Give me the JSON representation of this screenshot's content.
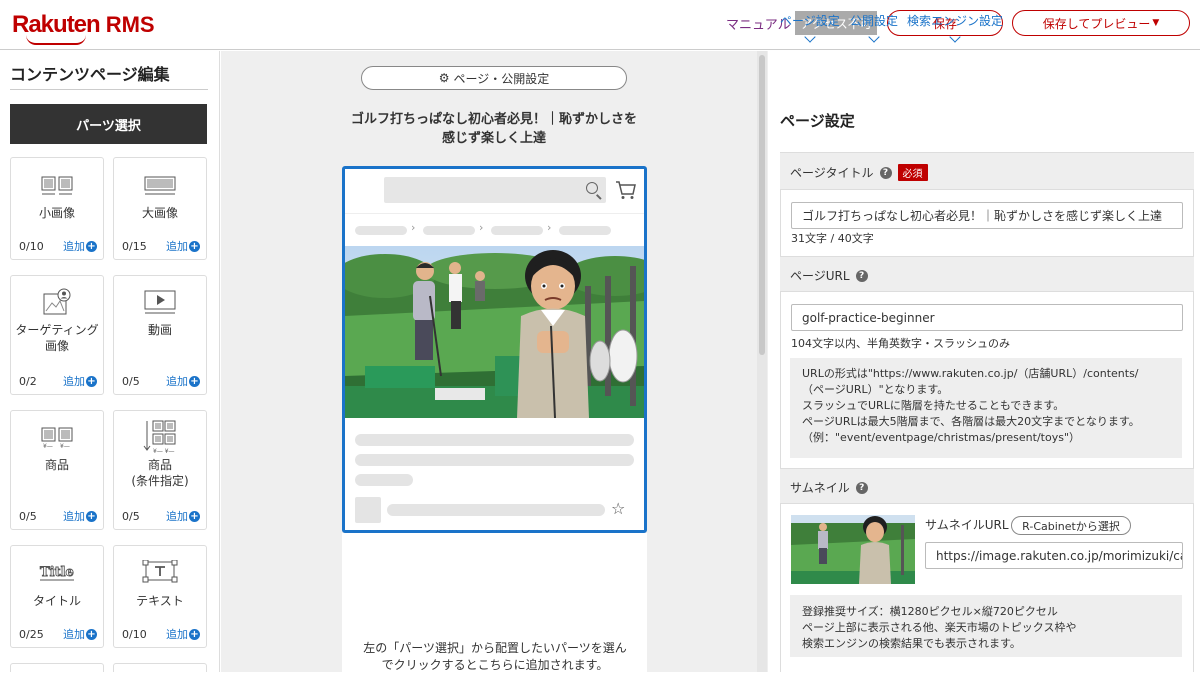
{
  "header": {
    "logo_main": "Rakuten",
    "logo_sub": "RMS",
    "manual": "マニュアル",
    "access": "アクセス不可",
    "save": "保存",
    "save_preview": "保存してプレビュー",
    "brand_color": "#bf0000"
  },
  "left": {
    "title": "コンテンツページ編集",
    "tab": "パーツ選択",
    "add_label": "追加",
    "parts": [
      {
        "icon": "small-image-icon",
        "label": "小画像",
        "count": "0/10"
      },
      {
        "icon": "large-image-icon",
        "label": "大画像",
        "count": "0/15"
      },
      {
        "icon": "targeting-image-icon",
        "label": "ターゲティング画像",
        "count": "0/2"
      },
      {
        "icon": "video-icon",
        "label": "動画",
        "count": "0/5"
      },
      {
        "icon": "product-icon",
        "label": "商品",
        "count": "0/5"
      },
      {
        "icon": "product-condition-icon",
        "label": "商品\n(条件指定)",
        "count": "0/5"
      },
      {
        "icon": "title-icon",
        "label": "タイトル",
        "count": "0/25"
      },
      {
        "icon": "text-icon",
        "label": "テキスト",
        "count": "0/10"
      }
    ]
  },
  "center": {
    "settings_button": "ページ・公開設定",
    "page_heading": "ゴルフ打ちっぱなし初心者必見！｜恥ずかしさを感じず楽しく上達",
    "hint": "左の「パーツ選択」から配置したいパーツを選んでクリックするとこちらに追加されます。"
  },
  "right": {
    "tabs": [
      "ページ設定",
      "公開設定",
      "検索エンジン設定"
    ],
    "title": "ページ設定",
    "page_title_label": "ページタイトル",
    "required": "必須",
    "page_title_value": "ゴルフ打ちっぱなし初心者必見！｜恥ずかしさを感じず楽しく上達",
    "page_title_count": "31文字 / 40文字",
    "page_url_label": "ページURL",
    "page_url_value": "golf-practice-beginner",
    "page_url_note": "104文字以内、半角英数字・スラッシュのみ",
    "url_info": [
      "URLの形式は\"https://www.rakuten.co.jp/（店舗URL）/contents/",
      "（ページURL）\"となります。",
      "スラッシュでURLに階層を持たせることもできます。",
      "ページURLは最大5階層まで、各階層は最大20文字までとなります。",
      "（例：\"event/eventpage/christmas/present/toys\"）"
    ],
    "thumbnail_label": "サムネイル",
    "thumbnail_url_label": "サムネイルURL",
    "rcabinet_button": "R-Cabinetから選択",
    "thumbnail_url_value": "https://image.rakuten.co.jp/morimizuki/cabinet/g",
    "thumb_info": [
      "登録推奨サイズ：横1280ピクセル×縦720ピクセル",
      "ページ上部に表示される他、楽天市場のトピックス枠や",
      "検索エンジンの検索結果でも表示されます。"
    ],
    "link_color": "#1a73c9"
  }
}
